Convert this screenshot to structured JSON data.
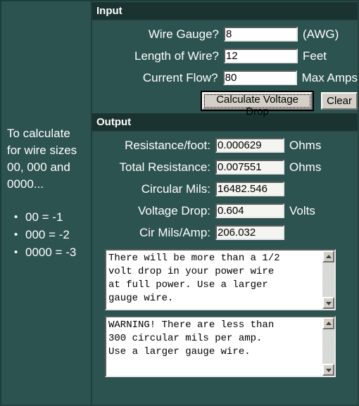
{
  "sidebar": {
    "note_text": "To calculate for wire sizes 00, 000 and 0000...",
    "bullets": [
      "00 = -1",
      "000 = -2",
      "0000 = -3"
    ]
  },
  "input_section": {
    "title": "Input",
    "rows": [
      {
        "label": "Wire Gauge?",
        "value": "8",
        "unit": "(AWG)"
      },
      {
        "label": "Length of Wire?",
        "value": "12",
        "unit": "Feet"
      },
      {
        "label": "Current Flow?",
        "value": "80",
        "unit": "Max Amps"
      }
    ],
    "calculate_label": "Calculate Voltage Drop",
    "clear_label": "Clear"
  },
  "output_section": {
    "title": "Output",
    "rows": [
      {
        "label": "Resistance/foot:",
        "value": "0.000629",
        "unit": "Ohms"
      },
      {
        "label": "Total Resistance:",
        "value": "0.007551",
        "unit": "Ohms"
      },
      {
        "label": "Circular Mils:",
        "value": "16482.546",
        "unit": ""
      },
      {
        "label": "Voltage Drop:",
        "value": "0.604",
        "unit": "Volts"
      },
      {
        "label": "Cir Mils/Amp:",
        "value": "206.032",
        "unit": ""
      }
    ],
    "messages": [
      "There will be more than a 1/2\nvolt drop in your power wire\nat full power. Use a larger\ngauge wire.",
      "WARNING! There are less than\n300 circular mils per amp.\nUse a larger gauge wire."
    ]
  },
  "icons": {
    "scroll_up": "scroll-up-arrow-icon",
    "scroll_down": "scroll-down-arrow-icon"
  },
  "colors": {
    "page_background": "#2d5350",
    "section_bar": "#1b3330",
    "text": "#ffffff",
    "field_background": "#ffffff",
    "output_field_background": "#f4f4f0",
    "button_face": "#d4d0c8"
  }
}
